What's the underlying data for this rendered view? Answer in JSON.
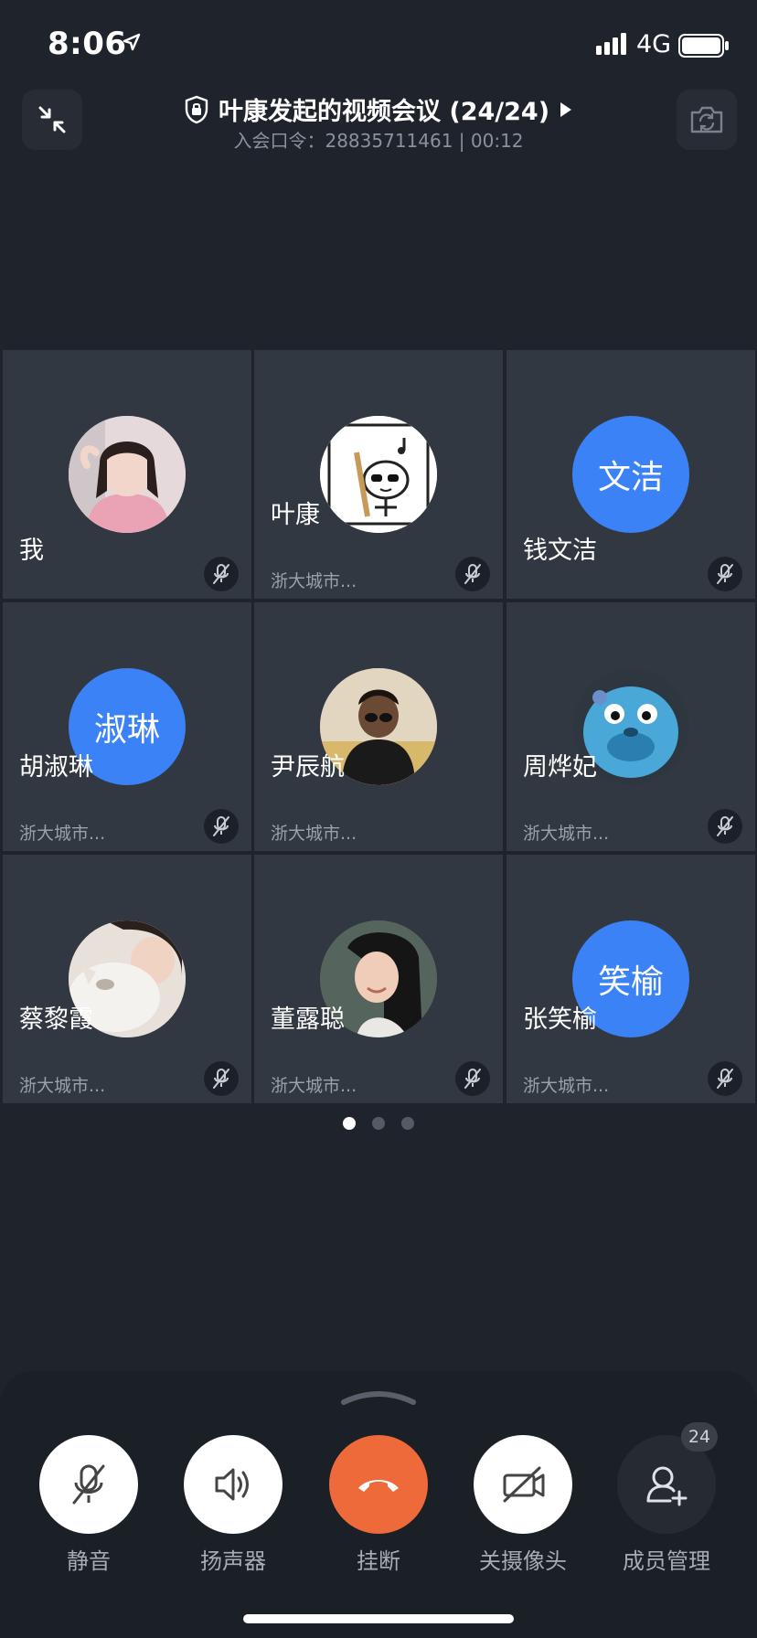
{
  "status_bar": {
    "time": "8:06",
    "network": "4G"
  },
  "header": {
    "title": "叶康发起的视频会议 (24/24)",
    "subtitle": "入会口令：28835711461 | 00:12"
  },
  "participants": [
    {
      "name": "我",
      "org": "",
      "avatar_text": "",
      "avatar_icon": "photo-girl-pink-shirt"
    },
    {
      "name": "叶康",
      "org": "浙大城市...",
      "avatar_text": "",
      "avatar_icon": "cartoon-sunglasses"
    },
    {
      "name": "钱文洁",
      "org": "",
      "avatar_text": "文洁",
      "avatar_icon": ""
    },
    {
      "name": "胡淑琳",
      "org": "浙大城市...",
      "avatar_text": "淑琳",
      "avatar_icon": ""
    },
    {
      "name": "尹辰航",
      "org": "浙大城市...",
      "avatar_text": "",
      "avatar_icon": "photo-child"
    },
    {
      "name": "周烨妃",
      "org": "浙大城市...",
      "avatar_text": "",
      "avatar_icon": "photo-blue-monster-plush"
    },
    {
      "name": "蔡黎霞",
      "org": "浙大城市...",
      "avatar_text": "",
      "avatar_icon": "photo-girl-with-cat"
    },
    {
      "name": "董露聪",
      "org": "浙大城市...",
      "avatar_text": "",
      "avatar_icon": "photo-girl-smiling"
    },
    {
      "name": "张笑榆",
      "org": "浙大城市...",
      "avatar_text": "笑榆",
      "avatar_icon": ""
    }
  ],
  "pagination": {
    "pages": 3,
    "current": 1
  },
  "controls": {
    "mute": "静音",
    "speaker": "扬声器",
    "hangup": "挂断",
    "camera_off": "关摄像头",
    "members": "成员管理",
    "members_count": "24"
  },
  "colors": {
    "background": "#1f232b",
    "tile": "#323841",
    "avatar_blue": "#3b82f6",
    "hangup_red": "#ee6a3a"
  }
}
